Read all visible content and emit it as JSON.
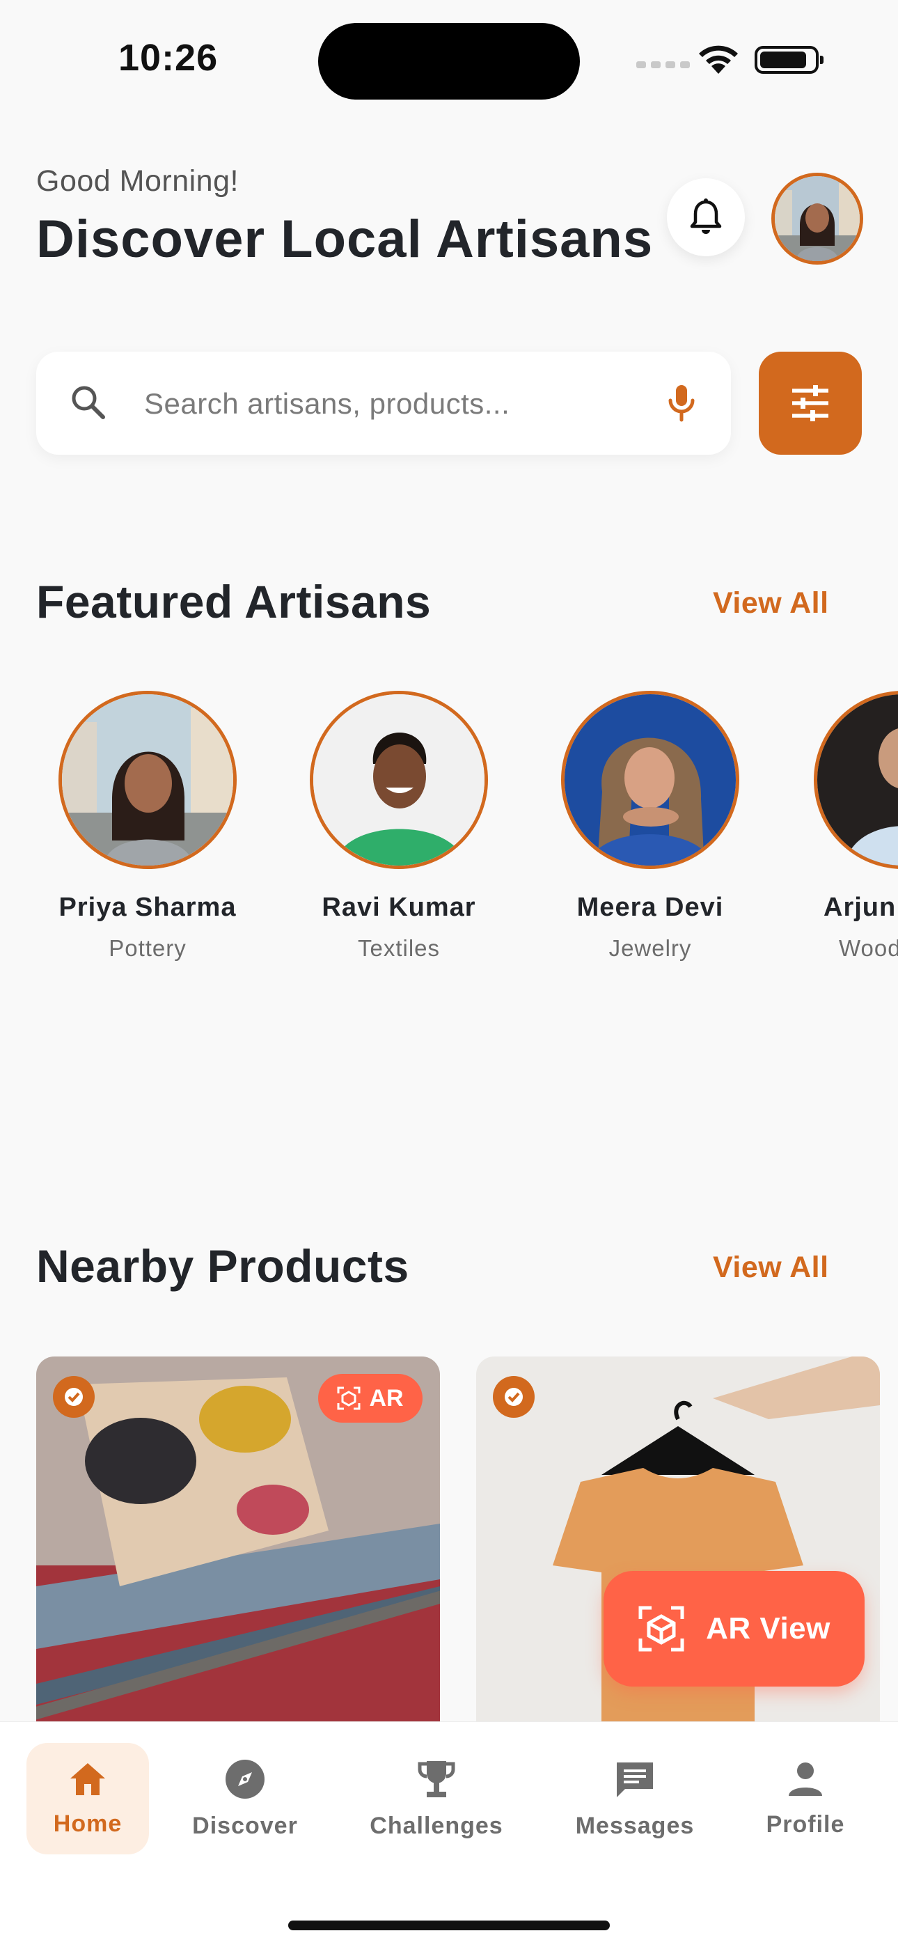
{
  "status_bar": {
    "time": "10:26"
  },
  "header": {
    "greeting": "Good Morning!",
    "title": "Discover Local Artisans"
  },
  "search": {
    "placeholder": "Search artisans, products...",
    "value": ""
  },
  "featured": {
    "title": "Featured Artisans",
    "view_all": "View All",
    "artisans": [
      {
        "name": "Priya Sharma",
        "craft": "Pottery"
      },
      {
        "name": "Ravi Kumar",
        "craft": "Textiles"
      },
      {
        "name": "Meera Devi",
        "craft": "Jewelry"
      },
      {
        "name": "Arjun",
        "craft": "Wood"
      }
    ]
  },
  "nearby": {
    "title": "Nearby Products",
    "view_all": "View All",
    "ar_chip": "AR",
    "ar_fab": "AR View"
  },
  "nav": {
    "items": [
      {
        "label": "Home",
        "icon": "home-icon"
      },
      {
        "label": "Discover",
        "icon": "compass-icon"
      },
      {
        "label": "Challenges",
        "icon": "trophy-icon"
      },
      {
        "label": "Messages",
        "icon": "message-icon"
      },
      {
        "label": "Profile",
        "icon": "person-icon"
      }
    ],
    "active": "Home"
  },
  "colors": {
    "accent": "#d2691e",
    "ar": "#ff6347",
    "background": "#f9f9f9",
    "text": "#22252a"
  }
}
